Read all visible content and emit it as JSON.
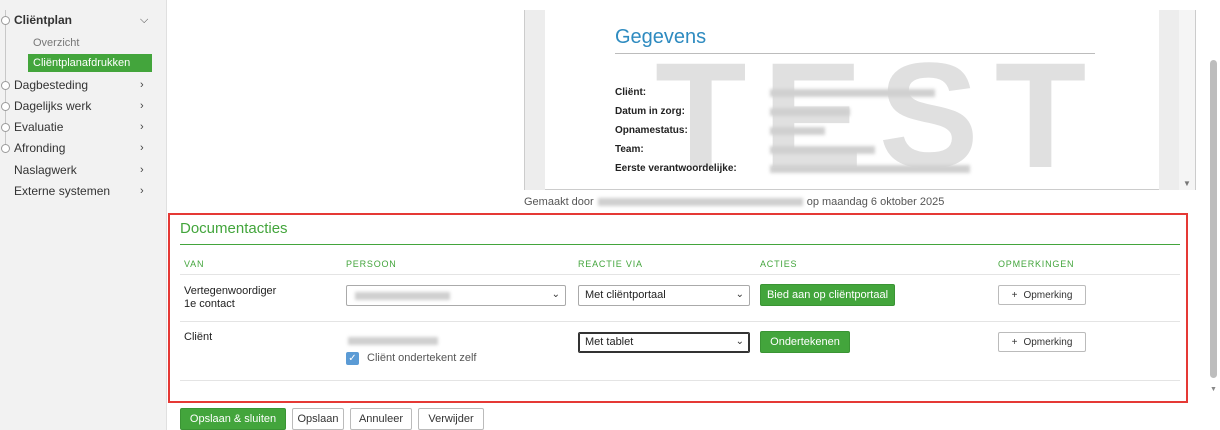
{
  "sidebar": {
    "clientplan": {
      "label": "Cliëntplan",
      "chevron": "chevron-down-icon"
    },
    "sub_items": [
      {
        "label": "Overzicht",
        "active": false
      },
      {
        "label": "Cliëntplanafdrukken",
        "active": true
      }
    ],
    "items": [
      {
        "label": "Dagbesteding",
        "chevron": "chevron-right-icon"
      },
      {
        "label": "Dagelijks werk",
        "chevron": "chevron-right-icon"
      },
      {
        "label": "Evaluatie",
        "chevron": "chevron-right-icon"
      },
      {
        "label": "Afronding",
        "chevron": "chevron-right-icon"
      },
      {
        "label": "Naslagwerk",
        "chevron": "chevron-right-icon"
      },
      {
        "label": "Externe systemen",
        "chevron": "chevron-right-icon"
      }
    ]
  },
  "preview": {
    "heading": "Gegevens",
    "watermark": "TEST",
    "fields": [
      {
        "label": "Cliënt:"
      },
      {
        "label": "Datum in zorg:"
      },
      {
        "label": "Opnamestatus:"
      },
      {
        "label": "Team:"
      },
      {
        "label": "Eerste verantwoordelijke:"
      }
    ]
  },
  "created": {
    "prefix": "Gemaakt door",
    "suffix": "op maandag 6 oktober 2025"
  },
  "documentacties": {
    "title": "Documentacties",
    "columns": {
      "van": "VAN",
      "persoon": "PERSOON",
      "reactie_via": "REACTIE VIA",
      "acties": "ACTIES",
      "opmerkingen": "OPMERKINGEN"
    },
    "rows": [
      {
        "van_line1": "Vertegenwoordiger",
        "van_line2": "1e contact",
        "reactie_via": "Met cliëntportaal",
        "action": "Bied aan op cliëntportaal",
        "remark": "Opmerking"
      },
      {
        "van_line1": "Cliënt",
        "self_sign_label": "Cliënt ondertekent zelf",
        "reactie_via": "Met tablet",
        "action": "Ondertekenen",
        "remark": "Opmerking"
      }
    ]
  },
  "footer": {
    "save_close": "Opslaan & sluiten",
    "save": "Opslaan",
    "cancel": "Annuleer",
    "delete": "Verwijder"
  },
  "colors": {
    "accent_green": "#43a53c",
    "highlight_red": "#e53935",
    "heading_blue": "#2e8bc0"
  }
}
